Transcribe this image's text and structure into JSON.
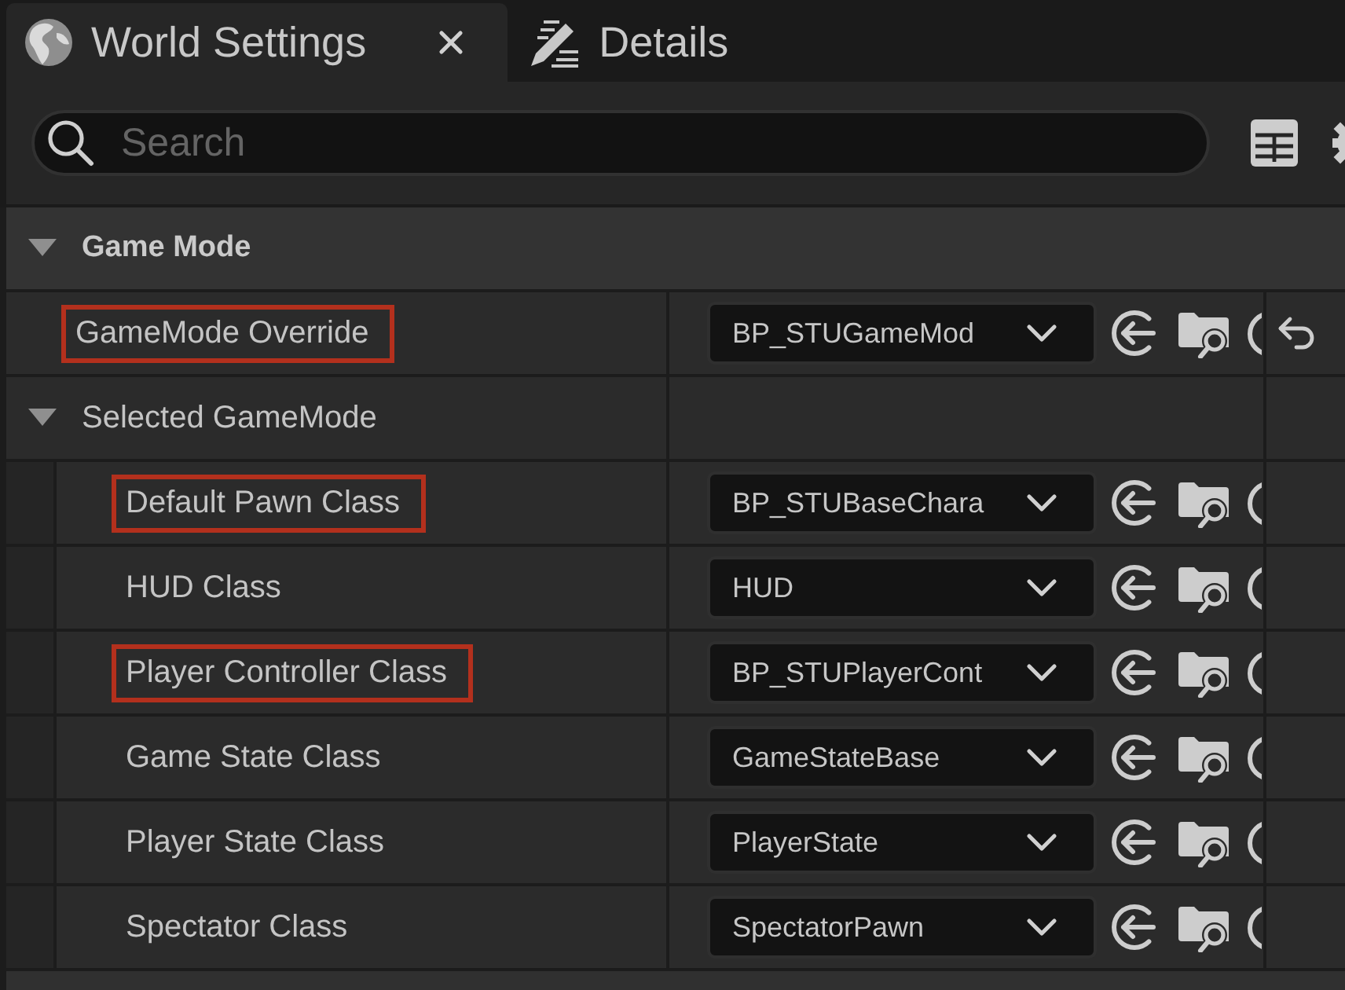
{
  "tabs": [
    {
      "label": "World Settings",
      "selected": true
    },
    {
      "label": "Details",
      "selected": false
    }
  ],
  "search": {
    "placeholder": "Search"
  },
  "categories": [
    {
      "label": "Game Mode",
      "expanded": true,
      "children": [
        {
          "kind": "property",
          "label": "GameMode Override",
          "value": "BP_STUGameMod",
          "highlighted": true,
          "resettable": true
        },
        {
          "kind": "group",
          "label": "Selected GameMode",
          "expanded": true,
          "children": [
            {
              "kind": "property",
              "label": "Default Pawn Class",
              "value": "BP_STUBaseChara",
              "highlighted": true,
              "resettable": false
            },
            {
              "kind": "property",
              "label": "HUD Class",
              "value": "HUD",
              "highlighted": false,
              "resettable": false
            },
            {
              "kind": "property",
              "label": "Player Controller Class",
              "value": "BP_STUPlayerCont",
              "highlighted": true,
              "resettable": false
            },
            {
              "kind": "property",
              "label": "Game State Class",
              "value": "GameStateBase",
              "highlighted": false,
              "resettable": false
            },
            {
              "kind": "property",
              "label": "Player State Class",
              "value": "PlayerState",
              "highlighted": false,
              "resettable": false
            },
            {
              "kind": "property",
              "label": "Spectator Class",
              "value": "SpectatorPawn",
              "highlighted": false,
              "resettable": false
            }
          ]
        }
      ]
    }
  ]
}
